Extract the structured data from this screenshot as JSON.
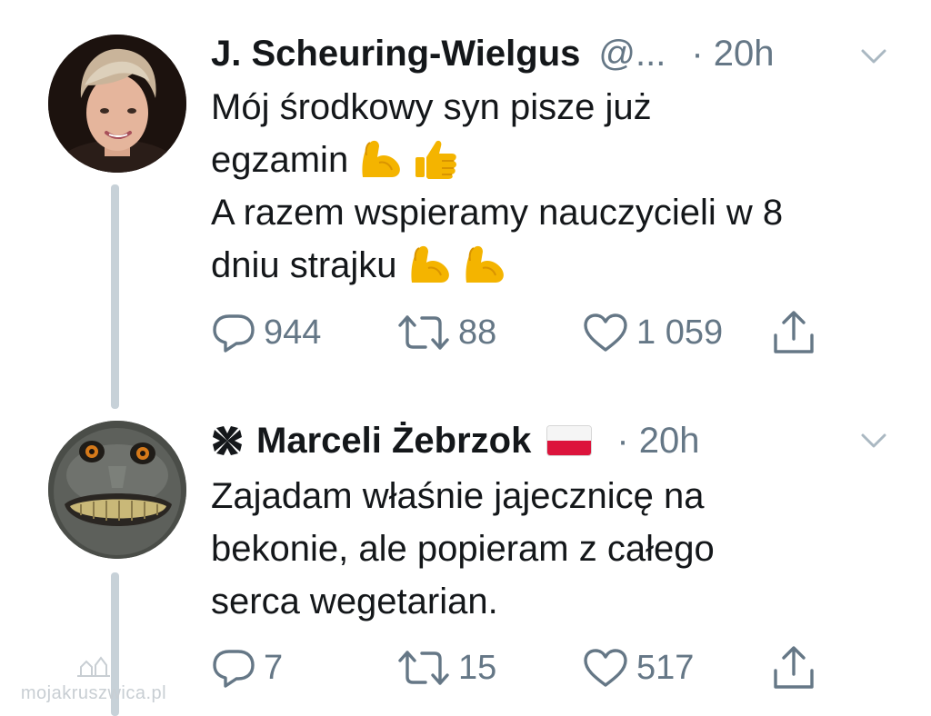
{
  "tweets": [
    {
      "name": "J. Scheuring-Wielgus",
      "handle": "@...",
      "time": "· 20h",
      "avatar_icon": "woman-portrait-avatar",
      "lines": [
        "Mój środkowy syn pisze już",
        "egzamin",
        "A razem wspieramy nauczycieli w 8",
        "dniu strajku"
      ],
      "emojis": {
        "line2": [
          "flexed-biceps-emoji",
          "thumbs-up-emoji"
        ],
        "line4": [
          "flexed-biceps-emoji",
          "flexed-biceps-emoji"
        ]
      },
      "actions": {
        "replies": "944",
        "retweets": "88",
        "likes": "1 059"
      }
    },
    {
      "name": "Marceli Żebrzok",
      "name_prefix_icon": "maltese-cross-icon",
      "flag_icon": "poland-flag-icon",
      "time": "· 20h",
      "avatar_icon": "grinning-monkey-avatar",
      "lines": [
        "Zajadam właśnie jajecznicę na",
        "bekonie, ale popieram z całego",
        "serca wegetarian."
      ],
      "actions": {
        "replies": "7",
        "retweets": "15",
        "likes": "517"
      }
    }
  ],
  "watermark": {
    "text": "mojakruszwica.pl"
  },
  "colors": {
    "text": "#14171a",
    "secondary": "#657786",
    "thread_line": "#c7d1d8",
    "emoji": "#f4b400",
    "flag_red": "#dc143c"
  }
}
